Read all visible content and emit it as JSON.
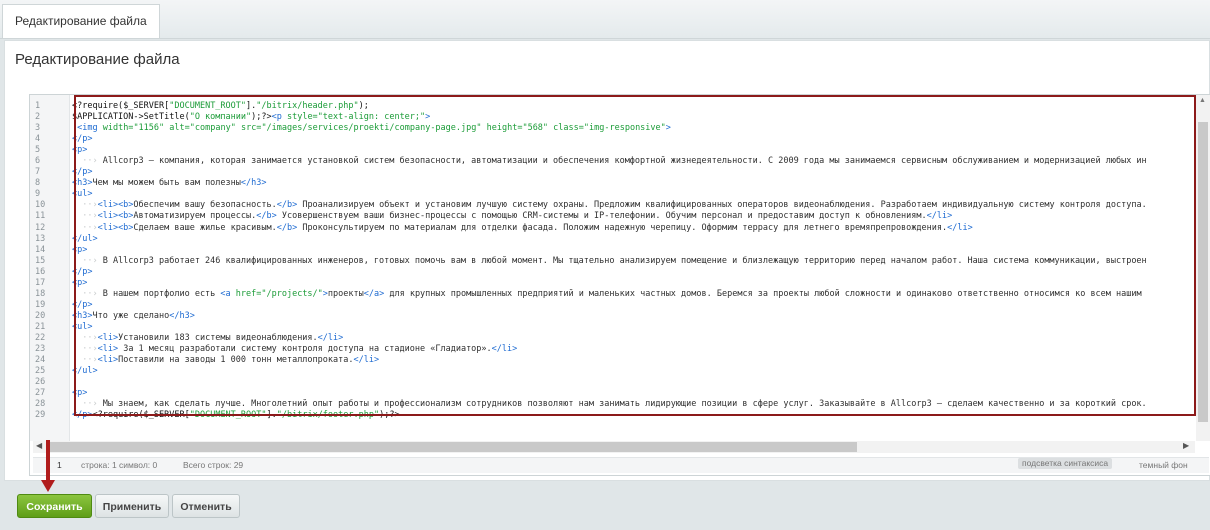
{
  "tab": {
    "label": "Редактирование файла"
  },
  "page": {
    "title": "Редактирование файла"
  },
  "editor": {
    "line_numbers": [
      "1",
      "2",
      "3",
      "4",
      "5",
      "6",
      "7",
      "8",
      "9",
      "10",
      "11",
      "12",
      "13",
      "14",
      "15",
      "16",
      "17",
      "18",
      "19",
      "20",
      "21",
      "22",
      "23",
      "24",
      "25",
      "26",
      "27",
      "28",
      "29"
    ]
  },
  "status": {
    "line_num": "1",
    "position": "строка: 1   символ: 0",
    "total": "Всего строк: 29",
    "syntax_toggle": "подсветка синтаксиса",
    "dark_bg": "темный фон"
  },
  "buttons": {
    "save": "Сохранить",
    "apply": "Применить",
    "cancel": "Отменить"
  },
  "colors": {
    "highlight_border": "#8c1a1a",
    "save_button": "#6aa824",
    "arrow": "#b01c1c"
  }
}
